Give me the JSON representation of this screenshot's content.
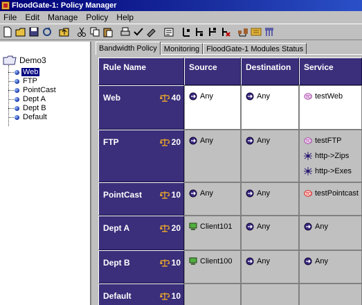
{
  "window": {
    "title": "FloodGate-1: Policy Manager"
  },
  "menu": [
    "File",
    "Edit",
    "Manage",
    "Policy",
    "Help"
  ],
  "toolbar_icons": [
    "new-icon",
    "open-icon",
    "save-icon",
    "refresh-icon",
    "sep",
    "up-folder-icon",
    "sep",
    "cut-icon",
    "copy-icon",
    "paste-icon",
    "sep",
    "print-icon",
    "verify-icon",
    "install-icon",
    "sep",
    "properties-icon",
    "sep",
    "add-rule-icon",
    "add-rule-below-icon",
    "add-rule-above-icon",
    "delete-rule-icon",
    "sep",
    "network-objects-icon",
    "services-icon",
    "resources-icon"
  ],
  "tree": {
    "root": "Demo3",
    "items": [
      "Web",
      "FTP",
      "PointCast",
      "Dept A",
      "Dept B",
      "Default"
    ],
    "selected": "Web"
  },
  "tabs": [
    "Bandwidth Policy",
    "Monitoring",
    "FloodGate-1 Modules Status"
  ],
  "active_tab": "Bandwidth Policy",
  "columns": [
    "Rule Name",
    "Source",
    "Destination",
    "Service"
  ],
  "rules": [
    {
      "name": "Web",
      "priority": "40",
      "source": [
        {
          "icon": "any",
          "text": "Any"
        }
      ],
      "destination": [
        {
          "icon": "any",
          "text": "Any"
        }
      ],
      "service": [
        {
          "icon": "service",
          "text": "testWeb"
        }
      ]
    },
    {
      "name": "FTP",
      "priority": "20",
      "source": [
        {
          "icon": "any",
          "text": "Any"
        }
      ],
      "destination": [
        {
          "icon": "any",
          "text": "Any"
        }
      ],
      "service": [
        {
          "icon": "service",
          "text": "testFTP"
        },
        {
          "icon": "url",
          "text": "http->Zips"
        },
        {
          "icon": "url",
          "text": "http->Exes"
        }
      ]
    },
    {
      "name": "PointCast",
      "priority": "10",
      "source": [
        {
          "icon": "any",
          "text": "Any"
        }
      ],
      "destination": [
        {
          "icon": "any",
          "text": "Any"
        }
      ],
      "service": [
        {
          "icon": "service-red",
          "text": "testPointcast"
        }
      ]
    },
    {
      "name": "Dept A",
      "priority": "20",
      "source": [
        {
          "icon": "host",
          "text": "Client101"
        }
      ],
      "destination": [
        {
          "icon": "any",
          "text": "Any"
        }
      ],
      "service": [
        {
          "icon": "any",
          "text": "Any"
        }
      ]
    },
    {
      "name": "Dept B",
      "priority": "10",
      "source": [
        {
          "icon": "host",
          "text": "Client100"
        }
      ],
      "destination": [
        {
          "icon": "any",
          "text": "Any"
        }
      ],
      "service": [
        {
          "icon": "any",
          "text": "Any"
        }
      ]
    },
    {
      "name": "Default",
      "priority": "10",
      "source": [],
      "destination": [],
      "service": []
    }
  ]
}
